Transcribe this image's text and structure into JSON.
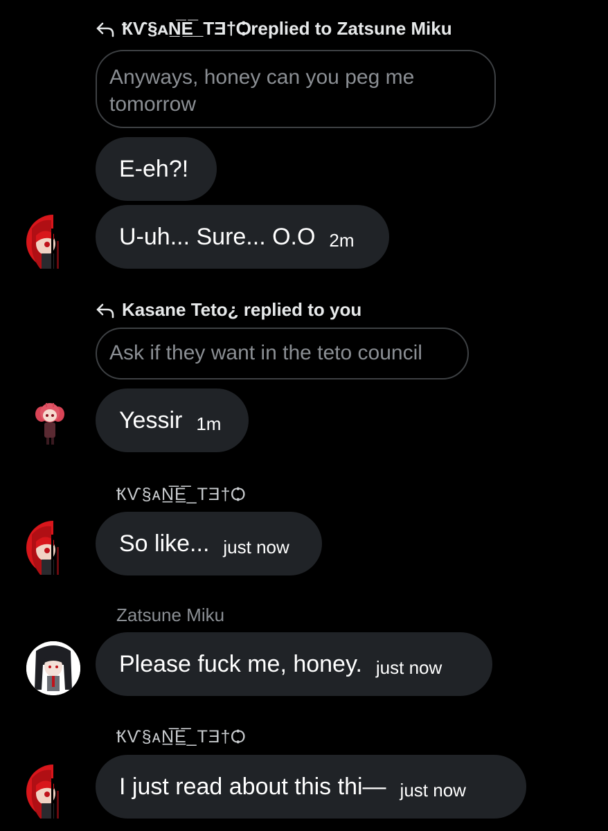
{
  "thread": {
    "reply1": {
      "header": "ҞѴ§ᴀN̲̅E̲̅_TƎ†Ѻreplied to Zatsune Miku",
      "quote": "Anyways, honey can you peg me tomorrow"
    },
    "msg1": {
      "text": "E-eh?!"
    },
    "msg2": {
      "text": "U-uh... Sure... O.O",
      "time": "2m"
    },
    "reply2": {
      "header": "Kasane Teto¿ replied to you",
      "quote": "Ask if they want in the teto council"
    },
    "msg3": {
      "text": "Yessir",
      "time": "1m"
    },
    "sender1": "ҞѴ§ᴀN̲̅E̲̅_TƎ†Ѻ",
    "msg4": {
      "text": "So like...",
      "time": "just now"
    },
    "sender2": "Zatsune Miku",
    "msg5": {
      "text": "Please fuck me, honey.",
      "time": "just now"
    },
    "sender3": "ҞѴ§ᴀN̲̅E̲̅_TƎ†Ѻ",
    "msg6": {
      "text": "I just read about this thi—",
      "time": "just now"
    }
  },
  "icons": {
    "reply": "reply-arrow-icon"
  },
  "colors": {
    "background": "#000000",
    "bubble": "#202327",
    "quote_border": "#3e4144",
    "muted_text": "#8b8f94",
    "avatar_red": "#d8161b"
  }
}
